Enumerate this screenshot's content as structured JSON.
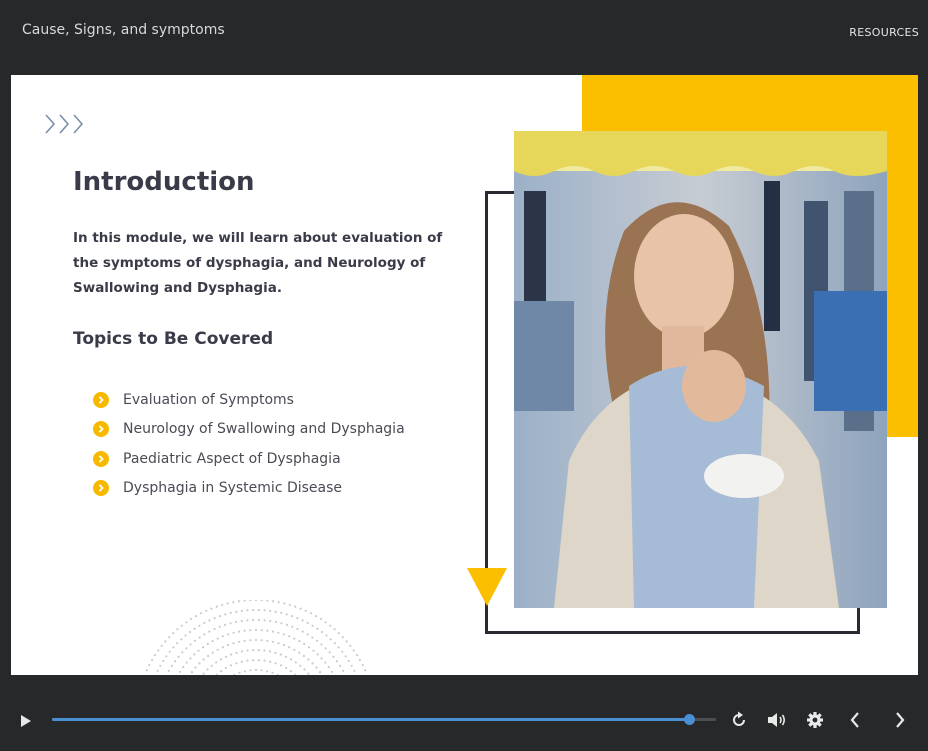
{
  "header": {
    "course_title": "Cause, Signs, and symptoms",
    "resources_label": "RESOURCES"
  },
  "slide": {
    "decor_icon": "triple-chevron-right-icon",
    "heading": "Introduction",
    "intro": "In this module, we will learn about evaluation of the symptoms of dysphagia, and Neurology of Swallowing and Dysphagia.",
    "topics_heading": "Topics to Be Covered",
    "topics": [
      {
        "label": "Evaluation of Symptoms",
        "icon": "chevron-circle-right-icon"
      },
      {
        "label": "Neurology of Swallowing and Dysphagia",
        "icon": "chevron-circle-right-icon"
      },
      {
        "label": "Paediatric Aspect of Dysphagia",
        "icon": "chevron-circle-right-icon"
      },
      {
        "label": "Dysphagia in Systemic Disease",
        "icon": "chevron-circle-right-icon"
      }
    ],
    "colors": {
      "accent": "#fcbf00",
      "text": "#3a3b48",
      "frame": "#272a33"
    }
  },
  "player": {
    "progress": 0.96,
    "icons": [
      "play-icon",
      "replay-icon",
      "volume-icon",
      "gear-icon",
      "chevron-left-icon",
      "chevron-right-icon"
    ],
    "accent": "#4a8fd1"
  }
}
